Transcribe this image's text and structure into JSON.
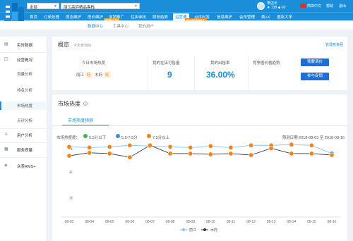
{
  "header": {
    "region_select": "全部",
    "store_select": "丽江高庐精品客栈",
    "user_name": "李店长",
    "user_stats": "★ 138  ◆ 60",
    "lang": "简体中文",
    "help": "帮助",
    "logout": "退出"
  },
  "nav": {
    "items": [
      "首页",
      "订单处理",
      "房态维护",
      "房价维护",
      "促销推广",
      "住店审核",
      "财务结算",
      "运营通",
      "点评问答",
      "信息维护",
      "会员管理",
      "美+X",
      "酒店大学"
    ],
    "active_index": 7,
    "badges": [
      "新增入驻",
      "限时促销推广"
    ]
  },
  "subnav": {
    "items": [
      "数据中心",
      "工具中心",
      "我的用户"
    ],
    "active_index": 0
  },
  "sidebar": {
    "items": [
      {
        "label": "实时数据",
        "icon": "realtime-icon",
        "type": "group"
      },
      {
        "label": "经营概况",
        "icon": "overview-icon",
        "type": "group"
      },
      {
        "label": "流量分析",
        "type": "sub"
      },
      {
        "label": "排名分析",
        "type": "sub"
      },
      {
        "label": "市场热度",
        "type": "sub",
        "active": true
      },
      {
        "label": "点评分析",
        "type": "sub"
      },
      {
        "label": "用户分析",
        "icon": "user-icon",
        "type": "group"
      },
      {
        "label": "服务质量",
        "icon": "service-icon",
        "type": "group"
      },
      {
        "label": "众荟RMS+",
        "icon": "rms-icon",
        "type": "group"
      }
    ]
  },
  "overview": {
    "title": "概览",
    "subtitle": "今天查询四",
    "manage_link": "管理竞争圈",
    "metrics": {
      "market_heat_label": "今日市场热度",
      "heat_city": "丽江",
      "heat_city_level": "旺",
      "heat_area": "木府",
      "heat_area_level": "旺",
      "saleable_label": "我的在店可售量",
      "saleable_value": "9",
      "occupancy_label": "我的出租率",
      "occupancy_value": "36.00%",
      "price_trend_label": "竞争圈价格趋势"
    },
    "btn_adjust": "我要调价",
    "btn_promo": "参与促销"
  },
  "market": {
    "title": "市场热度",
    "tab": "市场热度预测",
    "legend_title": "市场热度度：",
    "legend": [
      {
        "label": "5.5分以下",
        "color": "#4caf50"
      },
      {
        "label": "5.5-7.5分",
        "color": "#3a93d8"
      },
      {
        "label": "7.5分以上",
        "color": "#f08519"
      }
    ],
    "forecast_range": "预测日期 2018-08-03 至 2018-08-16",
    "y_labels": [
      "旺",
      "平",
      "淡"
    ]
  },
  "chart_data": {
    "type": "line",
    "categories": [
      "08-03",
      "08-04",
      "08-05",
      "08-06",
      "08-07",
      "08-08",
      "08-09",
      "08-10",
      "08-11",
      "08-12",
      "08-13",
      "08-14",
      "08-15",
      "08-16"
    ],
    "series": [
      {
        "name": "丽江",
        "color": "#7fc6ef",
        "values": [
          9.4,
          9.3,
          9.4,
          9.6,
          9.5,
          9.4,
          9.3,
          9.5,
          9.3,
          9.6,
          9.6,
          9.7,
          9.6,
          8.5
        ],
        "point_colors": [
          "#f08519",
          "#f08519",
          "#f08519",
          "#f08519",
          "#f08519",
          "#f08519",
          "#f08519",
          "#f08519",
          "#f08519",
          "#f08519",
          "#f08519",
          "#f08519",
          "#f08519",
          "#3a93d8"
        ]
      },
      {
        "name": "木府",
        "color": "#333333",
        "values": [
          8.2,
          8.6,
          8.5,
          8.0,
          9.6,
          8.5,
          8.5,
          8.4,
          8.5,
          8.3,
          9.2,
          8.5,
          8.5,
          8.3
        ],
        "point_colors": [
          "#f08519",
          "#f08519",
          "#f08519",
          "#f08519",
          "#f08519",
          "#f08519",
          "#f08519",
          "#f08519",
          "#f08519",
          "#f08519",
          "#f08519",
          "#f08519",
          "#f08519",
          "#f08519"
        ]
      }
    ],
    "y_range": [
      0,
      10
    ],
    "y_ticks_text": [
      "旺",
      "平",
      "淡"
    ],
    "legend": [
      "丽江",
      "木府"
    ],
    "legend_position": "bottom"
  }
}
